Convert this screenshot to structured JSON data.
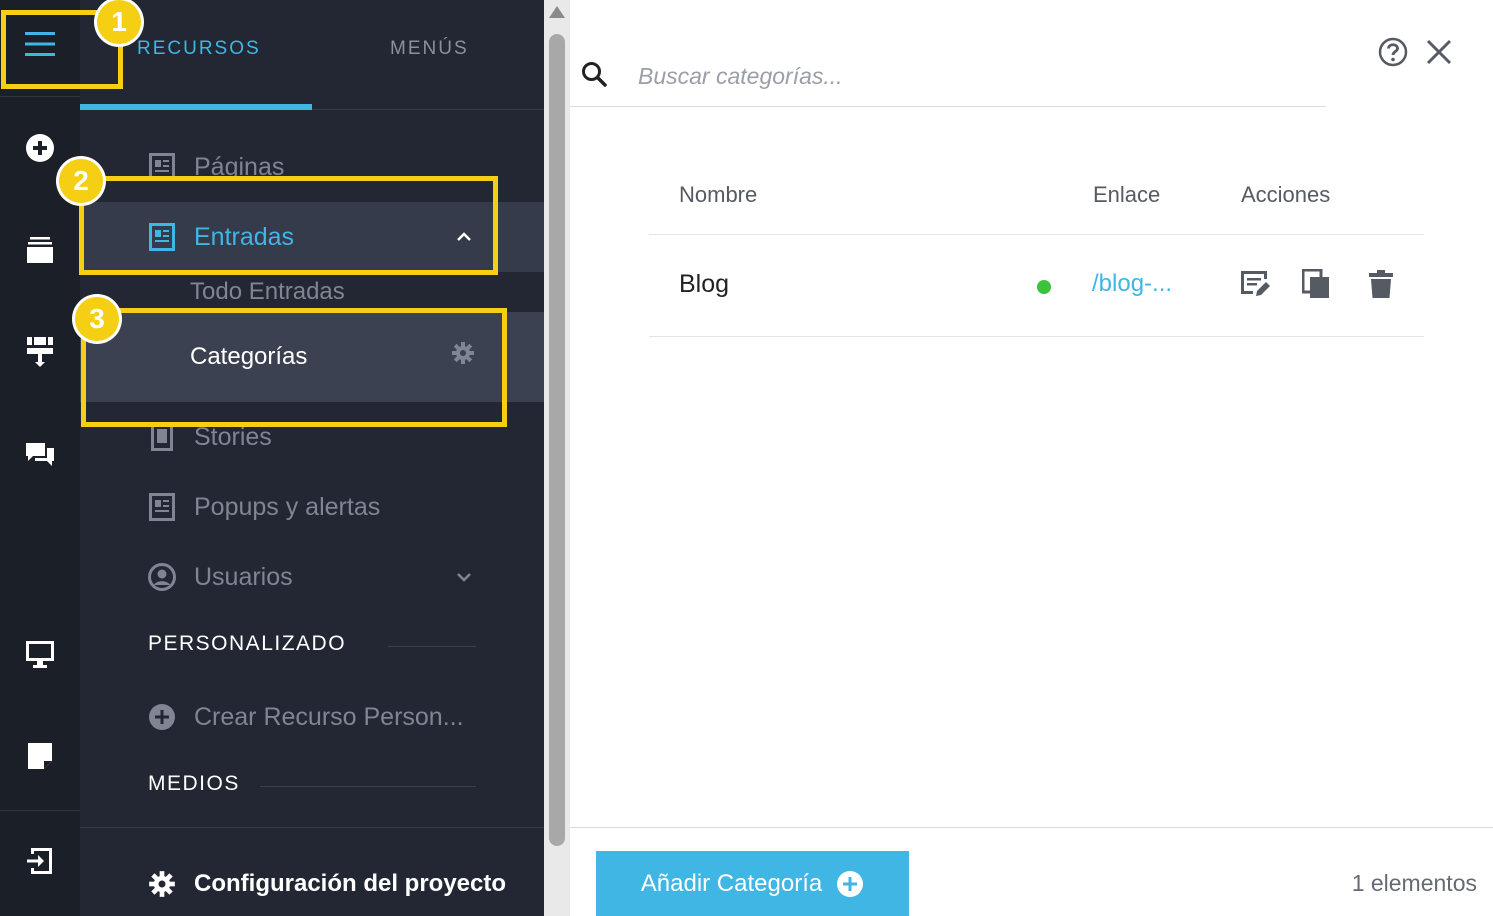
{
  "tabs": {
    "recursos": "RECURSOS",
    "menus": "MENÚS"
  },
  "sidebar": {
    "paginas": "Páginas",
    "entradas": "Entradas",
    "todo_entradas": "Todo Entradas",
    "categorias": "Categorías",
    "stories": "Stories",
    "popups": "Popups y alertas",
    "usuarios": "Usuarios",
    "personalizado": "PERSONALIZADO",
    "crear_recurso": "Crear Recurso Person...",
    "medios": "MEDIOS",
    "configuracion": "Configuración del proyecto"
  },
  "search": {
    "placeholder": "Buscar categorías..."
  },
  "table": {
    "headers": {
      "nombre": "Nombre",
      "enlace": "Enlace",
      "acciones": "Acciones"
    },
    "rows": [
      {
        "nombre": "Blog",
        "enlace": "/blog-...",
        "status": "active"
      }
    ]
  },
  "footer": {
    "add_label": "Añadir Categoría",
    "count": "1 elementos"
  },
  "callouts": [
    "1",
    "2",
    "3"
  ],
  "colors": {
    "accent": "#3fb6e4",
    "highlight": "#f5cf13",
    "status_active": "#3cc33c",
    "rail_bg": "#1b1f28",
    "panel_bg": "#222733"
  }
}
